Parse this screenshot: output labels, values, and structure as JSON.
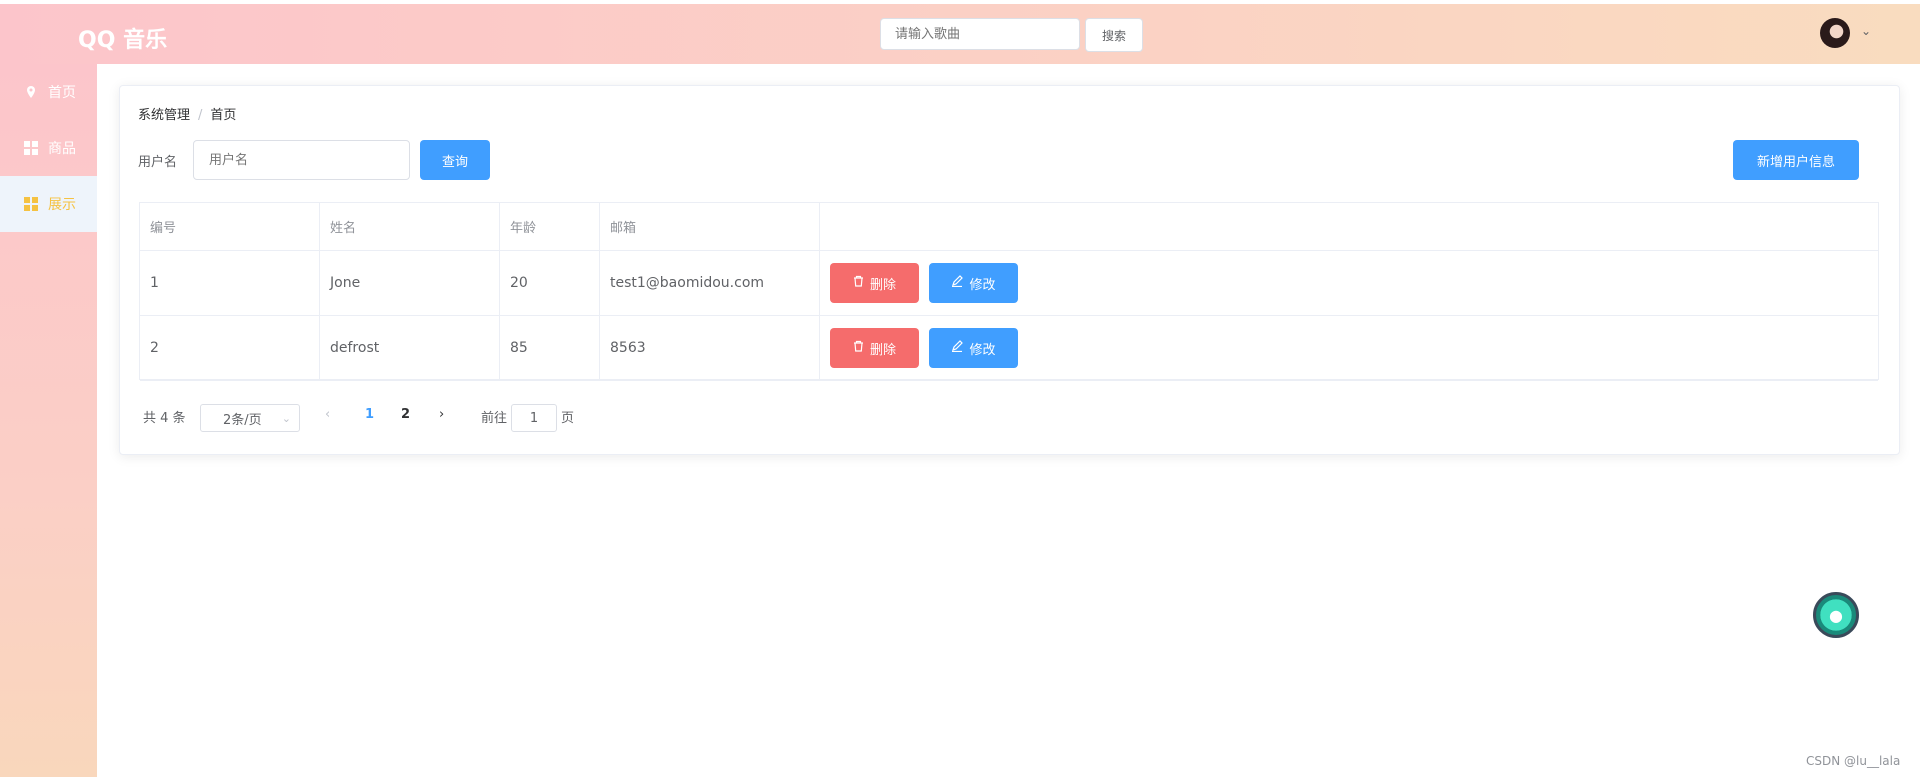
{
  "header": {
    "logo": "QQ 音乐",
    "search_placeholder": "请输入歌曲",
    "search_button": "搜索"
  },
  "sidebar": {
    "items": [
      {
        "label": "首页",
        "icon": "location-icon"
      },
      {
        "label": "商品",
        "icon": "grid-icon"
      },
      {
        "label": "展示",
        "icon": "grid-icon",
        "active": true
      }
    ]
  },
  "breadcrumb": [
    "系统管理",
    "首页"
  ],
  "filter": {
    "label": "用户名",
    "placeholder": "用户名",
    "query_button": "查询",
    "add_button": "新增用户信息"
  },
  "table": {
    "columns": [
      "编号",
      "姓名",
      "年龄",
      "邮箱",
      ""
    ],
    "rows": [
      {
        "id": "1",
        "name": "Jone",
        "age": "20",
        "email": "test1@baomidou.com"
      },
      {
        "id": "2",
        "name": "defrost",
        "age": "85",
        "email": "8563"
      }
    ],
    "delete_label": "删除",
    "edit_label": "修改"
  },
  "pagination": {
    "total": "共 4 条",
    "page_size": "2条/页",
    "pages": [
      "1",
      "2"
    ],
    "current_page": "1",
    "goto_label": "前往",
    "goto_value": "1",
    "page_suffix": "页"
  },
  "watermark": "CSDN @lu__lala",
  "colors": {
    "primary": "#409eff",
    "danger": "#f56c6c",
    "active_menu": "#f5c242"
  }
}
